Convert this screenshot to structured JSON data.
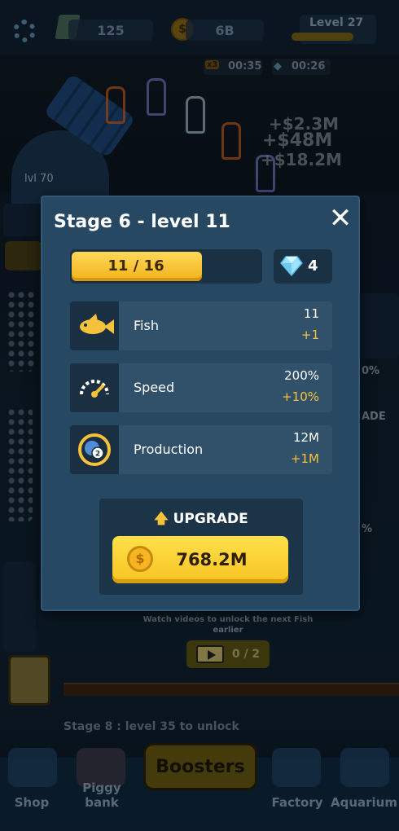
{
  "hud": {
    "gems": "125",
    "coins": "6B",
    "level_label": "Level 27",
    "boost_timer_1": "00:35",
    "boost_timer_2": "00:26",
    "boost_badge": "x3"
  },
  "background": {
    "cannon_level": "lvl 70",
    "floating_income": [
      "+$2.3M",
      "+$48M",
      "+$18.2M"
    ],
    "side_tags": [
      "0%",
      "ADE",
      "%"
    ],
    "watch_text": "Watch videos to unlock the next Fish earlier",
    "video_progress": "0 / 2",
    "unlock_text": "Stage 8 : level 35 to unlock"
  },
  "modal": {
    "title": "Stage 6 - level 11",
    "close_icon": "✕",
    "progress_text": "11 / 16",
    "progress_fraction": 0.6875,
    "gem_count": "4",
    "stats": [
      {
        "icon": "fish-icon",
        "label": "Fish",
        "value": "11",
        "delta": "+1"
      },
      {
        "icon": "speedometer-icon",
        "label": "Speed",
        "value": "200%",
        "delta": "+10%"
      },
      {
        "icon": "production-icon",
        "label": "Production",
        "value": "12M",
        "delta": "+1M"
      }
    ],
    "upgrade_title": "UPGRADE",
    "upgrade_price": "768.2M",
    "coin_symbol": "$"
  },
  "nav": {
    "items": [
      "Shop",
      "Piggy bank",
      "Boosters",
      "Factory",
      "Aquarium"
    ]
  },
  "colors": {
    "accent_yellow": "#f5c33b",
    "modal_bg": "#264863",
    "row_bg": "#31506a"
  }
}
